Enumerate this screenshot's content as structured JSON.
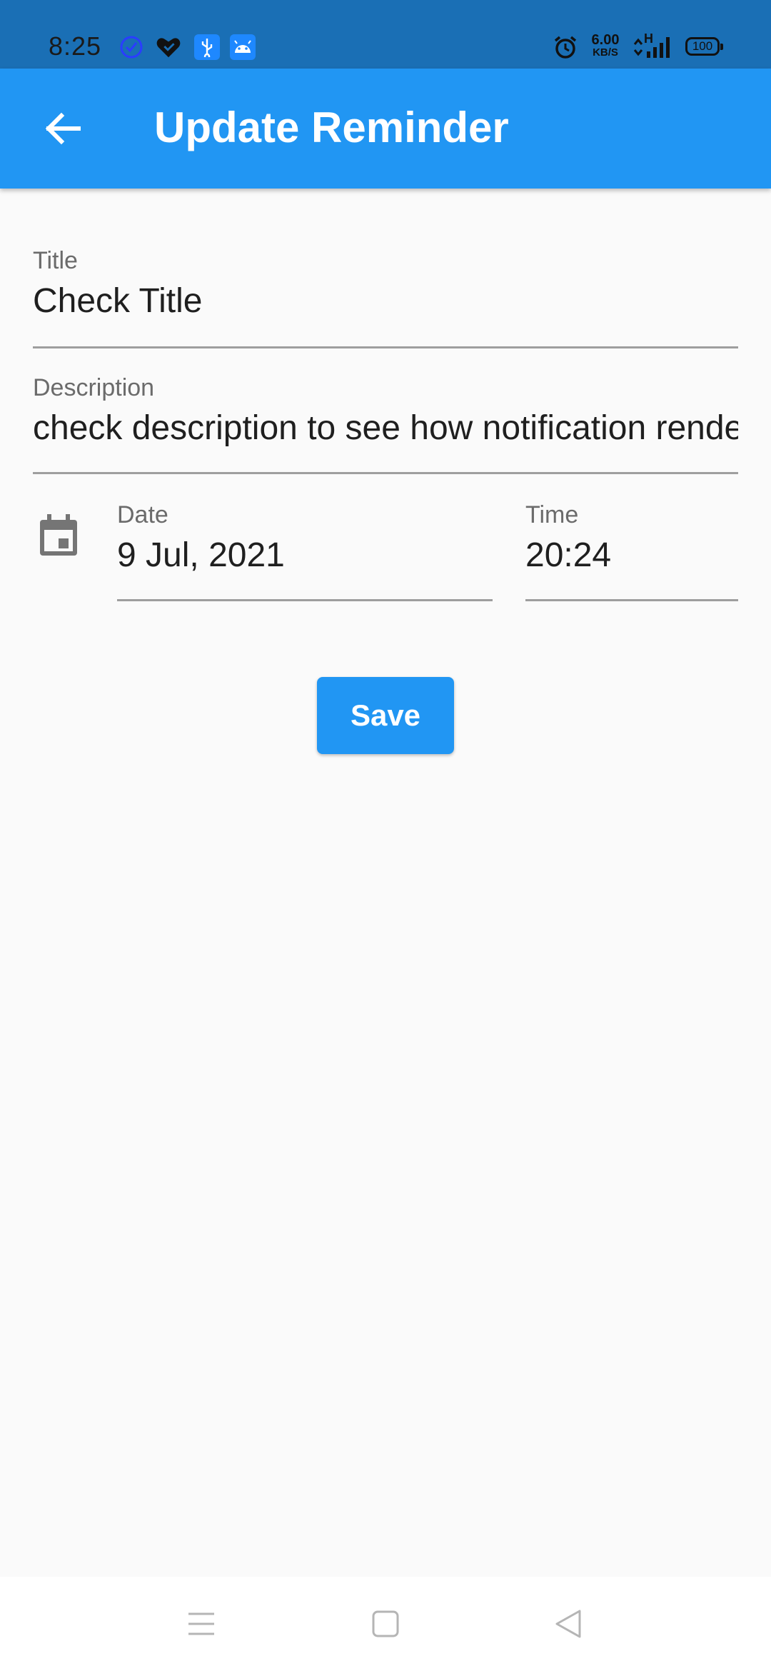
{
  "status_bar": {
    "time": "8:25",
    "net_speed_value": "6.00",
    "net_speed_unit": "KB/S",
    "network_type": "H",
    "battery": "100",
    "icons": [
      "clock-check-icon",
      "heart-check-icon",
      "usb-icon",
      "android-icon",
      "alarm-icon",
      "data-arrows-icon",
      "signal-icon",
      "battery-icon"
    ]
  },
  "app_bar": {
    "title": "Update Reminder",
    "back_icon": "arrow-back-icon",
    "color": "#2196f3"
  },
  "form": {
    "title_field": {
      "label": "Title",
      "value": "Check Title"
    },
    "description_field": {
      "label": "Description",
      "value": "check description to see how notification renders"
    },
    "date_field": {
      "label": "Date",
      "value": "9 Jul, 2021",
      "icon": "calendar-icon"
    },
    "time_field": {
      "label": "Time",
      "value": "20:24"
    }
  },
  "actions": {
    "save_label": "Save"
  },
  "nav_bar": {
    "items": [
      "menu-icon",
      "home-square-icon",
      "back-triangle-icon"
    ]
  }
}
